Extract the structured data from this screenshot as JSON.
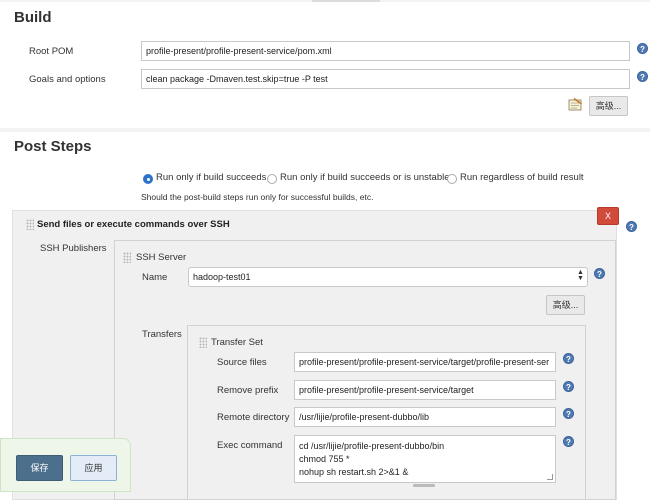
{
  "build": {
    "title": "Build",
    "root_pom_label": "Root POM",
    "root_pom_value": "profile-present/profile-present-service/pom.xml",
    "goals_label": "Goals and options",
    "goals_value": "clean package -Dmaven.test.skip=true -P test",
    "advanced_label": "高级..."
  },
  "post_steps": {
    "title": "Post Steps",
    "options": [
      "Run only if build succeeds",
      "Run only if build succeeds or is unstable",
      "Run regardless of build result"
    ],
    "selected": 0,
    "hint": "Should the post-build steps run only for successful builds, etc."
  },
  "ssh_step": {
    "title": "Send files or execute commands over SSH",
    "delete_label": "X",
    "publishers_label": "SSH Publishers",
    "server_title": "SSH Server",
    "name_label": "Name",
    "name_value": "hadoop-test01",
    "advanced_label": "高级...",
    "transfers_label": "Transfers",
    "transfer_set_title": "Transfer Set",
    "source_files_label": "Source files",
    "source_files_value": "profile-present/profile-present-service/target/profile-present-ser",
    "remove_prefix_label": "Remove prefix",
    "remove_prefix_value": "profile-present/profile-present-service/target",
    "remote_dir_label": "Remote directory",
    "remote_dir_value": "/usr/lijie/profile-present-dubbo/lib",
    "exec_label": "Exec command",
    "exec_lines": [
      "cd /usr/lijie/profile-present-dubbo/bin",
      "chmod 755 *",
      "nohup sh restart.sh 2>&1  &"
    ]
  },
  "footer": {
    "save_label": "保存",
    "apply_label": "应用"
  },
  "colors": {
    "help": "#4f7ab3",
    "delete": "#d24b3a",
    "save": "#4b6f8c",
    "radio_selected": "#2f73c9"
  }
}
